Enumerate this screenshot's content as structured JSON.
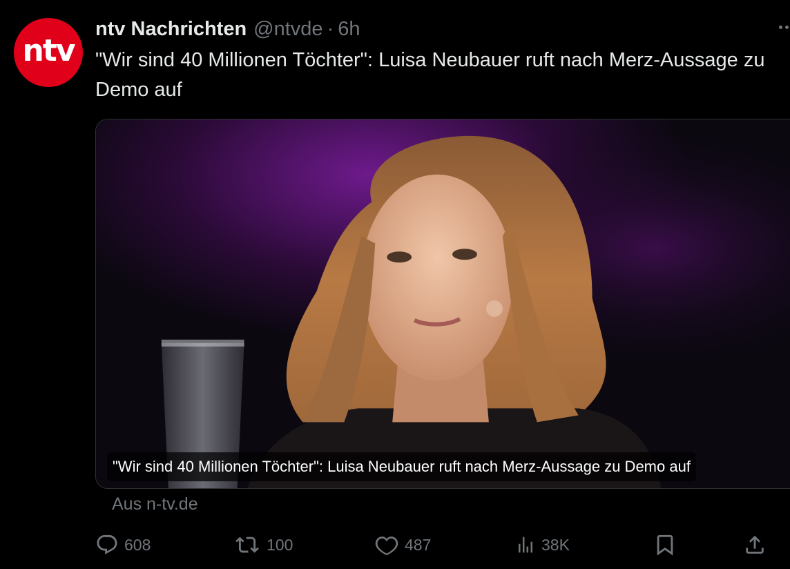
{
  "author": {
    "avatar_text": "ntv",
    "display_name": "ntv Nachrichten",
    "handle": "@ntvde",
    "separator": "·",
    "time": "6h"
  },
  "tweet": {
    "text": "\"Wir sind 40 Millionen Töchter\": Luisa Neubauer ruft nach Merz-Aussage zu Demo auf"
  },
  "card": {
    "caption": "\"Wir sind 40 Millionen Töchter\": Luisa Neubauer ruft nach Merz-Aussage zu Demo auf",
    "source": "Aus n-tv.de"
  },
  "actions": {
    "replies": "608",
    "reposts": "100",
    "likes": "487",
    "views": "38K"
  },
  "colors": {
    "background": "#000000",
    "brand_red": "#e1001a",
    "muted_text": "#71767b",
    "primary_text": "#e7e9ea",
    "border": "#2f3336"
  },
  "icons": [
    "more-icon",
    "reply-icon",
    "repost-icon",
    "like-icon",
    "views-icon",
    "bookmark-icon",
    "share-icon"
  ]
}
